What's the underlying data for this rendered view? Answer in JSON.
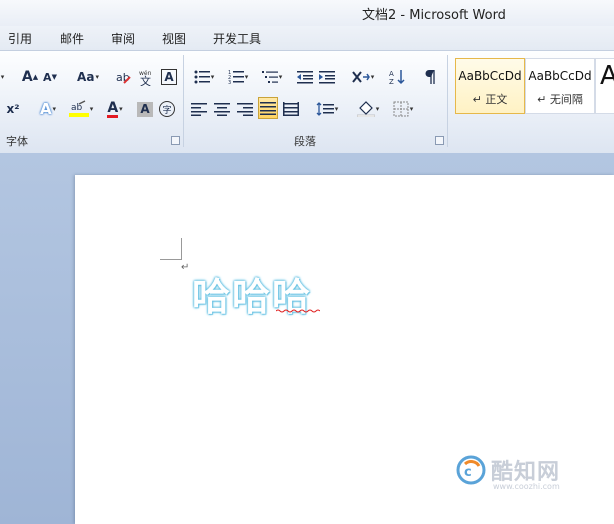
{
  "window": {
    "title": "文档2 - Microsoft Word"
  },
  "menu": [
    "引用",
    "邮件",
    "审阅",
    "视图",
    "开发工具"
  ],
  "ribbon": {
    "groups": [
      {
        "label": "字体"
      },
      {
        "label": "段落"
      }
    ],
    "styles": [
      {
        "sample": "AaBbCcDd",
        "name": "↵ 正文",
        "selected": true
      },
      {
        "sample": "AaBbCcDd",
        "name": "↵ 无间隔",
        "selected": false
      },
      {
        "sample": "A",
        "name": "",
        "selected": false
      }
    ],
    "font_buttons_row1": [
      "grow-font",
      "shrink-font",
      "change-case",
      "clear-format",
      "phonetic-guide",
      "char-border"
    ],
    "font_buttons_row2": [
      "superscript",
      "text-effect",
      "highlight",
      "font-color",
      "char-shading",
      "enclose-char"
    ],
    "para_buttons_row1": [
      "bullets",
      "numbering",
      "multilevel-list",
      "decrease-indent",
      "increase-indent",
      "chinese-layout",
      "sort",
      "show-marks"
    ],
    "para_buttons_row2": [
      "align-left",
      "center",
      "align-right",
      "justify",
      "distributed",
      "line-spacing",
      "shading",
      "borders"
    ],
    "labels": {
      "grow": "A",
      "shrink": "A",
      "case": "Aa",
      "border_char": "A",
      "superscript": "x²",
      "text_effect": "A",
      "font_color": "A",
      "shading": "A",
      "enclose": "字",
      "phonetic": "wén",
      "sort": "A Z"
    },
    "colors": {
      "font_color": "#e31b23",
      "highlight": "#ffff00",
      "accent": "#2b579a"
    }
  },
  "document": {
    "text": "哈哈哈",
    "paragraph_mark": "↵"
  },
  "watermark": {
    "brand": "酷知网",
    "url": "www.coozhi.com"
  }
}
